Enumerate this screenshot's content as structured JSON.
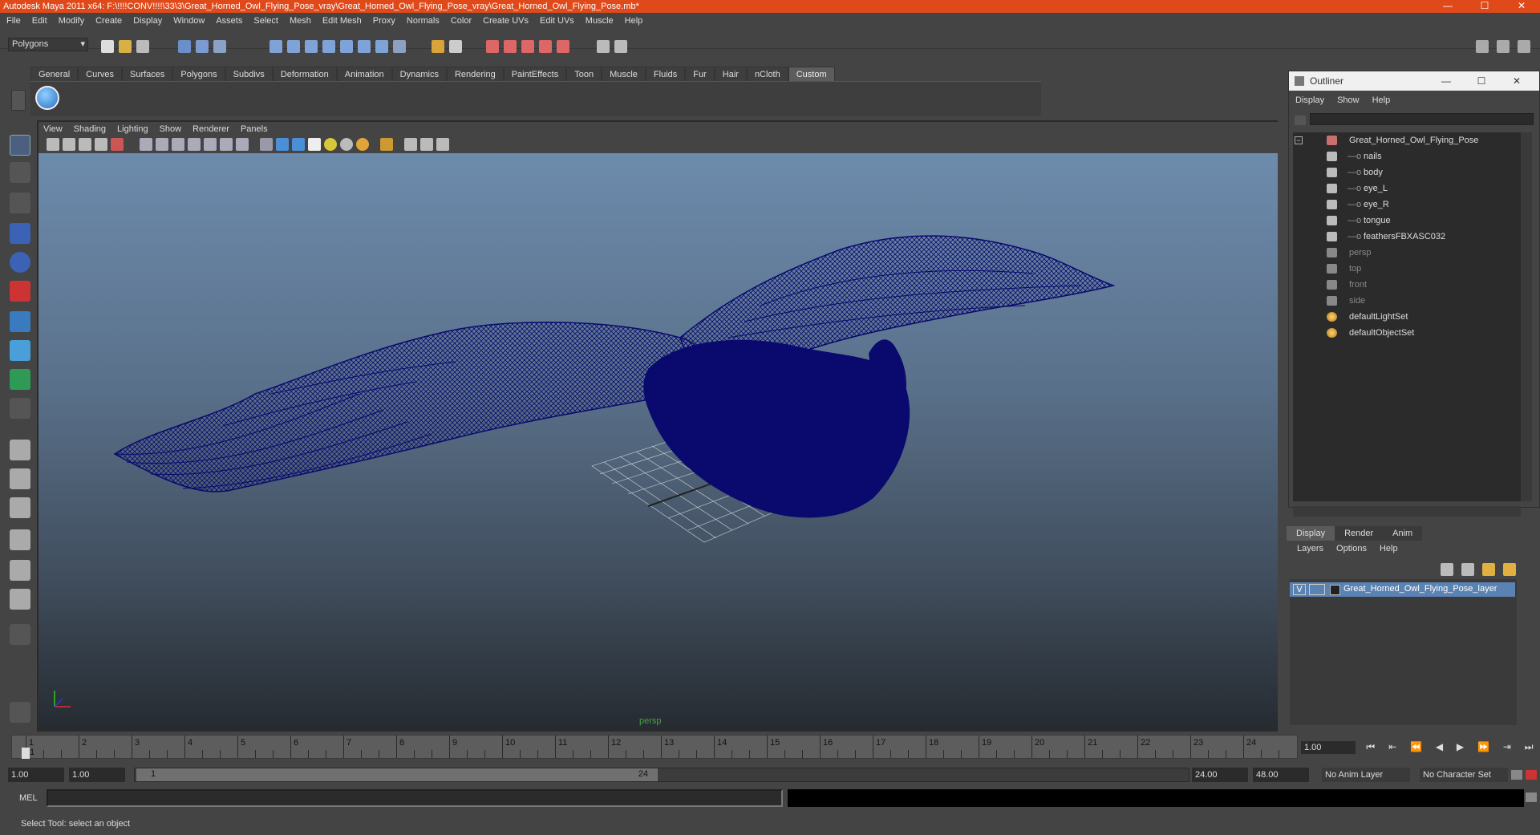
{
  "window": {
    "title": "Autodesk Maya 2011 x64: F:\\!!!!CONV!!!!\\33\\3\\Great_Horned_Owl_Flying_Pose_vray\\Great_Horned_Owl_Flying_Pose_vray\\Great_Horned_Owl_Flying_Pose.mb*"
  },
  "menubar": [
    "File",
    "Edit",
    "Modify",
    "Create",
    "Display",
    "Window",
    "Assets",
    "Select",
    "Mesh",
    "Edit Mesh",
    "Proxy",
    "Normals",
    "Color",
    "Create UVs",
    "Edit UVs",
    "Muscle",
    "Help"
  ],
  "mode_select": "Polygons",
  "shelf_tabs": [
    "General",
    "Curves",
    "Surfaces",
    "Polygons",
    "Subdivs",
    "Deformation",
    "Animation",
    "Dynamics",
    "Rendering",
    "PaintEffects",
    "Toon",
    "Muscle",
    "Fluids",
    "Fur",
    "Hair",
    "nCloth",
    "Custom"
  ],
  "shelf_active": "Custom",
  "panel_menu": [
    "View",
    "Shading",
    "Lighting",
    "Show",
    "Renderer",
    "Panels"
  ],
  "viewport": {
    "camera": "persp",
    "model_color": "#0a0a6e"
  },
  "outliner": {
    "title": "Outliner",
    "menu": [
      "Display",
      "Show",
      "Help"
    ],
    "items": [
      {
        "label": "Great_Horned_Owl_Flying_Pose",
        "depth": 0,
        "kind": "group"
      },
      {
        "label": "nails",
        "depth": 1,
        "kind": "mesh"
      },
      {
        "label": "body",
        "depth": 1,
        "kind": "mesh"
      },
      {
        "label": "eye_L",
        "depth": 1,
        "kind": "mesh"
      },
      {
        "label": "eye_R",
        "depth": 1,
        "kind": "mesh"
      },
      {
        "label": "tongue",
        "depth": 1,
        "kind": "mesh"
      },
      {
        "label": "feathersFBXASC032",
        "depth": 1,
        "kind": "mesh"
      },
      {
        "label": "persp",
        "depth": 0,
        "kind": "camera"
      },
      {
        "label": "top",
        "depth": 0,
        "kind": "camera"
      },
      {
        "label": "front",
        "depth": 0,
        "kind": "camera"
      },
      {
        "label": "side",
        "depth": 0,
        "kind": "camera"
      },
      {
        "label": "defaultLightSet",
        "depth": 0,
        "kind": "set"
      },
      {
        "label": "defaultObjectSet",
        "depth": 0,
        "kind": "set"
      }
    ]
  },
  "layer_editor": {
    "tabs": [
      "Display",
      "Render",
      "Anim"
    ],
    "active_tab": "Display",
    "menu": [
      "Layers",
      "Options",
      "Help"
    ],
    "layer": {
      "visible": "V",
      "name": "Great_Horned_Owl_Flying_Pose_layer"
    }
  },
  "time_slider": {
    "ticks": [
      "1",
      "2",
      "3",
      "4",
      "5",
      "6",
      "7",
      "8",
      "9",
      "10",
      "11",
      "12",
      "13",
      "14",
      "15",
      "16",
      "17",
      "18",
      "19",
      "20",
      "21",
      "22",
      "23",
      "24"
    ],
    "current_frame_marker": "1",
    "current_frame": "1.00"
  },
  "range": {
    "start_time": "1.00",
    "playback_start": "1.00",
    "slider_start": "1",
    "slider_end": "24",
    "playback_end": "24.00",
    "end_time": "48.00",
    "anim_layer": "No Anim Layer",
    "character_set": "No Character Set"
  },
  "command_line": {
    "label": "MEL"
  },
  "help_line": "Select Tool: select an object"
}
